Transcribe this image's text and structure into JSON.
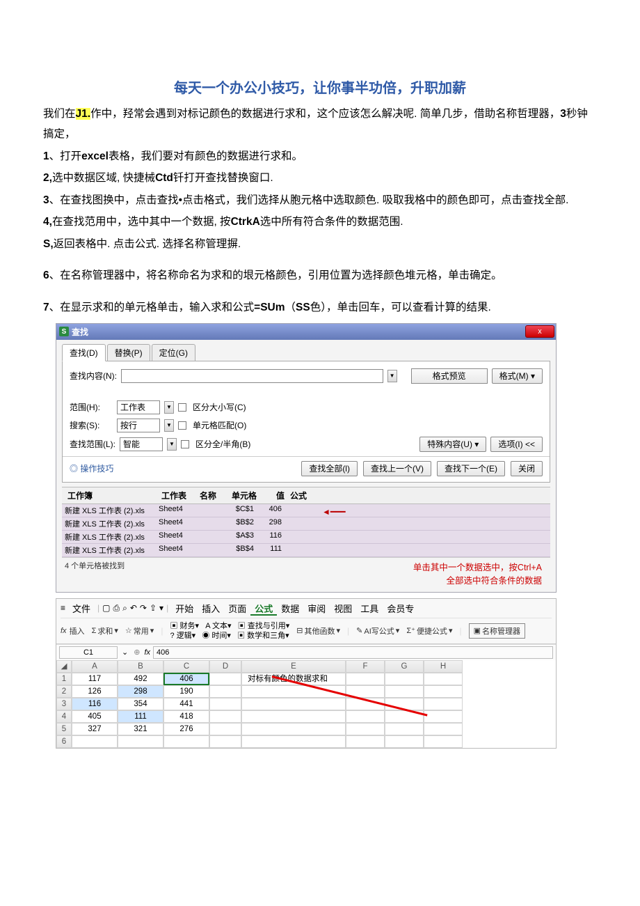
{
  "title": "每天一个办公小技巧，让你事半功倍，升职加薪",
  "para": {
    "intro_a": "我们在",
    "intro_hl": "J1.",
    "intro_b": "作中，羟常会遇到对标记颜色的数据进行求和，这个应该怎么解决呢. 简单几步，借助名称哲理器，",
    "intro_c": "3",
    "intro_d": "秒钟搞定，",
    "s1a": "1",
    "s1b": "、打开",
    "s1c": "excel",
    "s1d": "表格，我们要对有颜色的数据进行求和。",
    "s2a": "2,",
    "s2b": "选中数据区域, 快捷械",
    "s2c": "Ctd",
    "s2d": "钎打开查找替换窗口.",
    "s3a": "3",
    "s3b": "、在查找图换中，点击查找•点击格式，我们选择从胞元格中选取颜色. 吸取我格中的颜色即可，点击查找全部.",
    "s4a": "4,",
    "s4b": "在查找范用中，选中其中一个数据, 按",
    "s4c": "CtrkA",
    "s4d": "选中所有符合条件的数据范围.",
    "s5a": "S,",
    "s5b": "返回表格中. 点击公式. 选择名称管理摒.",
    "s6a": "6",
    "s6b": "、在名称管理器中，将名称命名为求和的垠元格颜色，引用位置为选择颜色堆元格，单击确定。",
    "s7a": "7",
    "s7b": "、在显示求和的单元格单击，输入求和公式",
    "s7c": "=SUm",
    "s7d": "（",
    "s7e": "SS",
    "s7f": "色），单击回车，可以查看计算的结果."
  },
  "dlg1": {
    "title": "查找",
    "tab_find": "查找(D)",
    "tab_replace": "替换(P)",
    "tab_goto": "定位(G)",
    "lbl_content": "查找内容(N):",
    "fmt_preview": "格式预览",
    "fmt_btn": "格式(M)",
    "lbl_scope": "范围(H):",
    "scope_val": "工作表",
    "chk_case": "区分大小写(C)",
    "lbl_search": "搜索(S):",
    "search_val": "按行",
    "chk_cell": "单元格匹配(O)",
    "lbl_look": "查找范围(L):",
    "look_val": "智能",
    "chk_half": "区分全/半角(B)",
    "special": "特殊内容(U)",
    "options": "选项(I) <<",
    "tips": "操作技巧",
    "btn_all": "查找全部(l)",
    "btn_prev": "查找上一个(V)",
    "btn_next": "查找下一个(E)",
    "btn_close": "关闭",
    "cols": {
      "wb": "工作簿",
      "ws": "工作表",
      "nm": "名称",
      "cl": "单元格",
      "vl": "值",
      "fm": "公式"
    },
    "rows": [
      {
        "wb": "新建 XLS 工作表 (2).xls",
        "ws": "Sheet4",
        "cl": "$C$1",
        "vl": "406"
      },
      {
        "wb": "新建 XLS 工作表 (2).xls",
        "ws": "Sheet4",
        "cl": "$B$2",
        "vl": "298"
      },
      {
        "wb": "新建 XLS 工作表 (2).xls",
        "ws": "Sheet4",
        "cl": "$A$3",
        "vl": "116"
      },
      {
        "wb": "新建 XLS 工作表 (2).xls",
        "ws": "Sheet4",
        "cl": "$B$4",
        "vl": "111"
      }
    ],
    "status": "4 个单元格被找到",
    "anno1": "单击其中一个数据选中，按Ctrl+A",
    "anno2": "全部选中符合条件的数据"
  },
  "ribbon": {
    "file": "文件",
    "menus": [
      "开始",
      "插入",
      "页面",
      "公式",
      "数据",
      "审阅",
      "视图",
      "工具",
      "会员专"
    ],
    "grp": {
      "insert": "插入",
      "sum": "求和",
      "fav": "常用",
      "fin": "财务",
      "txt": "文本",
      "log": "逻辑",
      "time": "时间",
      "lookup": "查找与引用",
      "math": "数学和三角",
      "other": "其他函数",
      "ai": "AI写公式",
      "quick": "便捷公式",
      "mgr": "名称管理器"
    },
    "namebox": "C1",
    "fx": "406",
    "colhead": [
      "A",
      "B",
      "C",
      "D",
      "E",
      "F",
      "G",
      "H"
    ],
    "cells": [
      [
        "117",
        "492",
        "406",
        "",
        "对标有颜色的数据求和",
        "",
        "",
        ""
      ],
      [
        "126",
        "298",
        "190",
        "",
        "",
        "",
        "",
        ""
      ],
      [
        "116",
        "354",
        "441",
        "",
        "",
        "",
        "",
        ""
      ],
      [
        "405",
        "111",
        "418",
        "",
        "",
        "",
        "",
        ""
      ],
      [
        "327",
        "321",
        "276",
        "",
        "",
        "",
        "",
        ""
      ],
      [
        "",
        "",
        "",
        "",
        "",
        "",
        "",
        ""
      ]
    ]
  }
}
